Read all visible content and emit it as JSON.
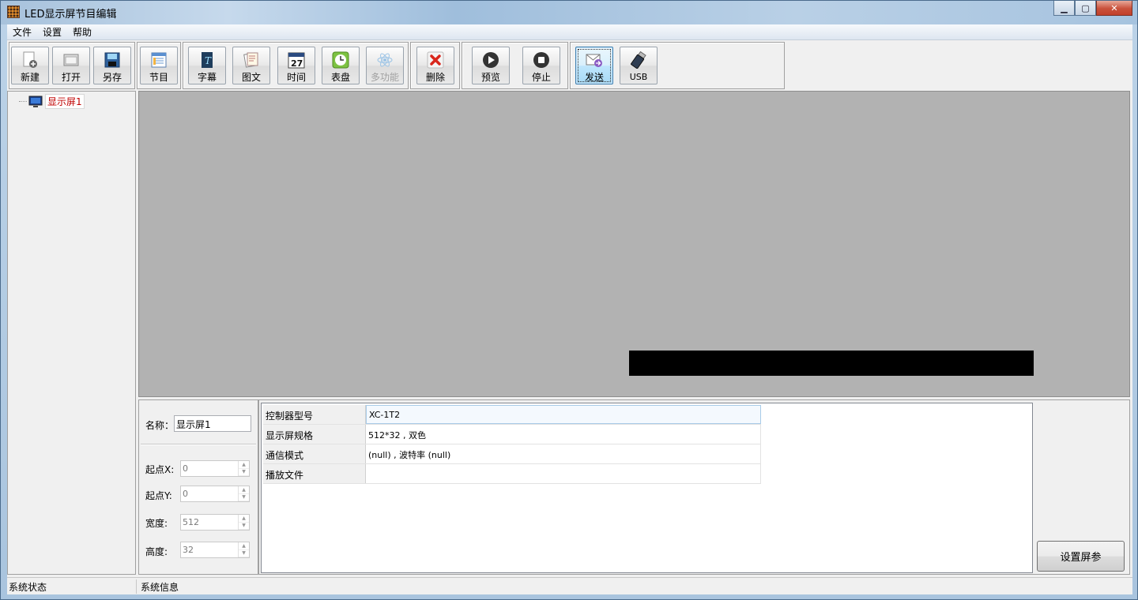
{
  "window": {
    "title": "LED显示屏节目编辑",
    "controls": {
      "minimize": "▁",
      "maximize": "▢",
      "close": "✕"
    }
  },
  "menu": [
    "文件",
    "设置",
    "帮助"
  ],
  "toolbar": {
    "new": "新建",
    "open": "打开",
    "save_as": "另存",
    "program": "节目",
    "subtitle": "字幕",
    "picture_text": "图文",
    "time": "时间",
    "clock": "表盘",
    "multi": "多功能",
    "delete": "删除",
    "preview": "预览",
    "stop": "停止",
    "send": "发送",
    "usb": "USB",
    "calendar_day": "27"
  },
  "tree": {
    "root_label": "显示屏1"
  },
  "properties": {
    "name_label": "名称：",
    "name_value": "显示屏1",
    "start_x_label": "起点X:",
    "start_x": "0",
    "start_y_label": "起点Y:",
    "start_y": "0",
    "width_label": "宽度:",
    "width": "512",
    "height_label": "高度:",
    "height": "32"
  },
  "info_grid": [
    {
      "key": "控制器型号",
      "value": "XC-1T2"
    },
    {
      "key": "显示屏规格",
      "value": "512*32 , 双色"
    },
    {
      "key": "通信模式",
      "value": "(null) , 波特率 (null)"
    },
    {
      "key": "播放文件",
      "value": ""
    }
  ],
  "buttons": {
    "set_screen_params": "设置屏参"
  },
  "status": {
    "system_status": "系统状态",
    "system_info": "系统信息"
  },
  "colors": {
    "canvas": "#b2b2b2",
    "screen": "#000000",
    "tree_label": "#c00000"
  }
}
